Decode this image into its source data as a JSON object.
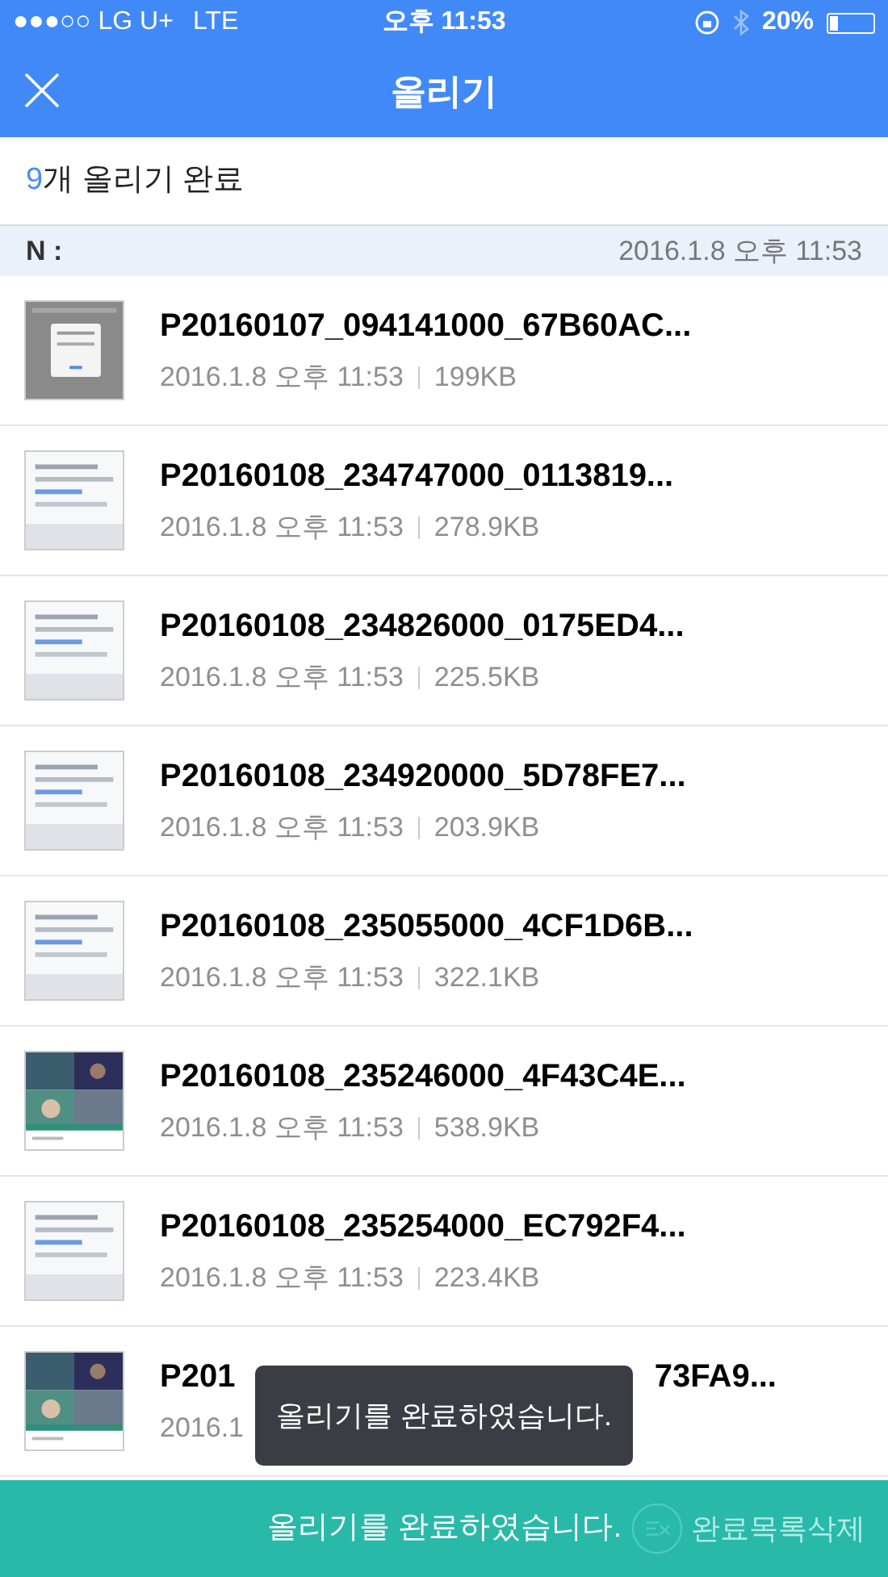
{
  "status_bar": {
    "carrier": "●●●○○ LG U+",
    "network": "LTE",
    "time": "오후 11:53",
    "battery": "20%"
  },
  "header": {
    "title": "올리기"
  },
  "summary": {
    "count": "9",
    "text": "개 올리기 완료"
  },
  "section": {
    "label": "N :",
    "date": "2016.1.8 오후 11:53"
  },
  "files": [
    {
      "kind": "full",
      "name": "P20160107_094141000_67B60AC...",
      "date": "2016.1.8 오후 11:53",
      "size": "199KB"
    },
    {
      "kind": "full",
      "name": "P20160108_234747000_0113819...",
      "date": "2016.1.8 오후 11:53",
      "size": "278.9KB"
    },
    {
      "kind": "full",
      "name": "P20160108_234826000_0175ED4...",
      "date": "2016.1.8 오후 11:53",
      "size": "225.5KB"
    },
    {
      "kind": "full",
      "name": "P20160108_234920000_5D78FE7...",
      "date": "2016.1.8 오후 11:53",
      "size": "203.9KB"
    },
    {
      "kind": "full",
      "name": "P20160108_235055000_4CF1D6B...",
      "date": "2016.1.8 오후 11:53",
      "size": "322.1KB"
    },
    {
      "kind": "full",
      "name": "P20160108_235246000_4F43C4E...",
      "date": "2016.1.8 오후 11:53",
      "size": "538.9KB"
    },
    {
      "kind": "full",
      "name": "P20160108_235254000_EC792F4...",
      "date": "2016.1.8 오후 11:53",
      "size": "223.4KB"
    },
    {
      "kind": "partial",
      "name_start": "P201",
      "name_end": "73FA9...",
      "date": "2016.1"
    }
  ],
  "toast": {
    "text": "올리기를 완료하였습니다."
  },
  "bottom_bar": {
    "message": "올리기를 완료하였습니다.",
    "action": "완료목록삭제"
  }
}
